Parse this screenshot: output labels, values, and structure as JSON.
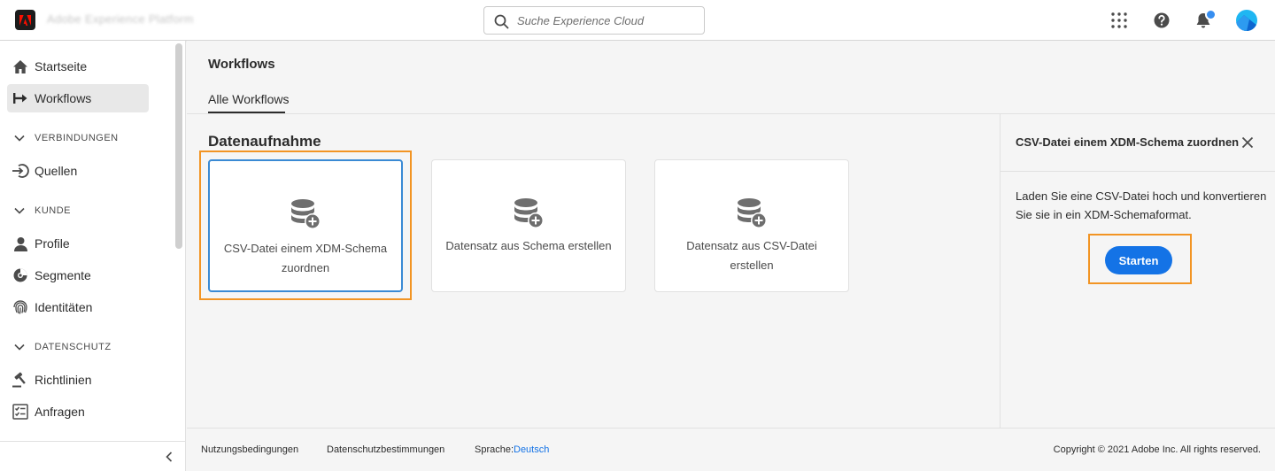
{
  "header": {
    "app_name": "Adobe Experience Platform",
    "search_placeholder": "Suche Experience Cloud",
    "icons": [
      "adobe-logo-icon",
      "search-icon",
      "apps-grid-icon",
      "help-icon",
      "bell-icon",
      "avatar"
    ]
  },
  "sidebar": {
    "items": [
      {
        "label": "Startseite",
        "icon": "home-icon"
      },
      {
        "label": "Workflows",
        "icon": "workflow-icon",
        "active": true
      }
    ],
    "sections": [
      {
        "title": "VERBINDUNGEN",
        "items": [
          {
            "label": "Quellen",
            "icon": "sources-icon"
          }
        ]
      },
      {
        "title": "KUNDE",
        "items": [
          {
            "label": "Profile",
            "icon": "user-icon"
          },
          {
            "label": "Segmente",
            "icon": "segments-icon"
          },
          {
            "label": "Identitäten",
            "icon": "fingerprint-icon"
          }
        ]
      },
      {
        "title": "DATENSCHUTZ",
        "items": [
          {
            "label": "Richtlinien",
            "icon": "gavel-icon"
          },
          {
            "label": "Anfragen",
            "icon": "checklist-icon"
          }
        ]
      }
    ]
  },
  "main": {
    "title": "Workflows",
    "tab": "Alle Workflows",
    "section_title": "Datenaufnahme",
    "cards": [
      {
        "label": "CSV-Datei einem XDM-Schema zuordnen",
        "selected": true
      },
      {
        "label": "Datensatz aus Schema erstellen"
      },
      {
        "label": "Datensatz aus CSV-Datei erstellen"
      }
    ]
  },
  "panel": {
    "title": "CSV-Datei einem XDM-Schema zuordnen",
    "description": "Laden Sie eine CSV-Datei hoch und konvertieren Sie sie in ein XDM-Schemaformat.",
    "button": "Starten"
  },
  "footer": {
    "terms": "Nutzungsbedingungen",
    "privacy": "Datenschutzbestimmungen",
    "language_label": "Sprache:",
    "language": "Deutsch",
    "copyright": "Copyright ©  2021 Adobe Inc.  All rights reserved."
  },
  "colors": {
    "accent": "#1473e6",
    "highlight": "#f29423",
    "selected_border": "#3a8ad4"
  }
}
